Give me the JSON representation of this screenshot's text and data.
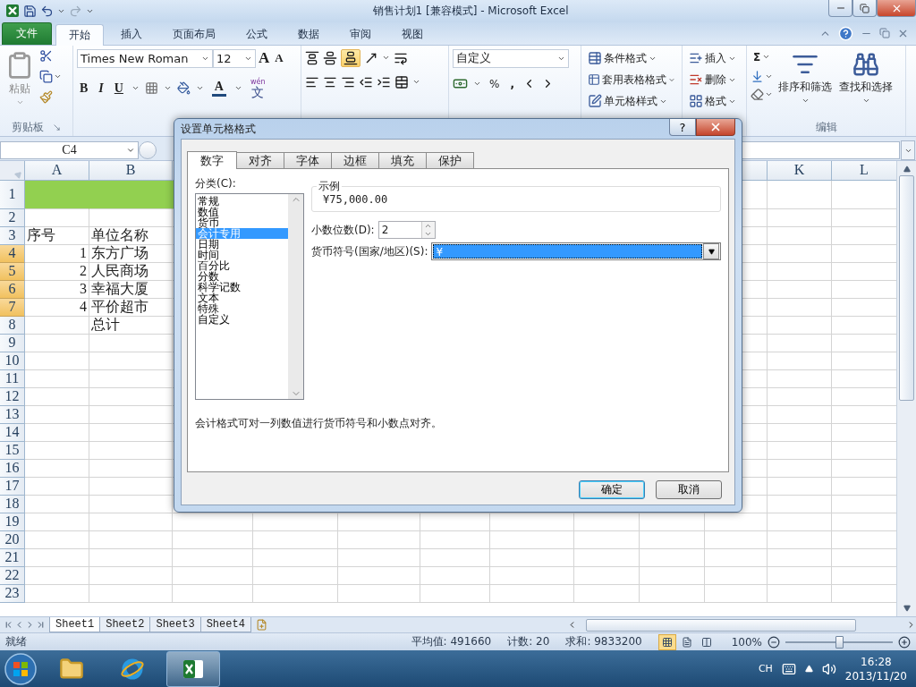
{
  "window": {
    "title": "销售计划1  [兼容模式]  -  Microsoft Excel"
  },
  "ribbon_tabs": [
    {
      "label": "文件",
      "kind": "file",
      "selected": false
    },
    {
      "label": "开始",
      "kind": "tab",
      "selected": true
    },
    {
      "label": "插入",
      "kind": "tab",
      "selected": false
    },
    {
      "label": "页面布局",
      "kind": "tab",
      "selected": false
    },
    {
      "label": "公式",
      "kind": "tab",
      "selected": false
    },
    {
      "label": "数据",
      "kind": "tab",
      "selected": false
    },
    {
      "label": "审阅",
      "kind": "tab",
      "selected": false
    },
    {
      "label": "视图",
      "kind": "tab",
      "selected": false
    }
  ],
  "ribbon": {
    "clipboard": {
      "paste": "粘贴",
      "label": "剪贴板"
    },
    "font": {
      "name": "Times New Roman",
      "size": "12",
      "grow": "A",
      "shrink": "A",
      "bold": "B",
      "italic": "I",
      "underline": "U",
      "font_color_letter": "A",
      "phonetic_ruby": "wén",
      "phonetic": "文"
    },
    "number": {
      "format": "自定义",
      "percent": "%",
      "comma": ","
    },
    "styles": [
      "条件格式",
      "套用表格格式",
      "单元格样式"
    ],
    "cells": [
      "插入",
      "删除",
      "格式"
    ],
    "editing": {
      "sum": "Σ",
      "sort": "排序和筛选",
      "find": "查找和选择",
      "label": "编辑"
    }
  },
  "name_box": "C4",
  "columns": [
    {
      "label": "A"
    },
    {
      "label": "B"
    },
    {},
    {},
    {},
    {},
    {},
    {},
    {},
    {},
    {
      "label": "K"
    },
    {
      "label": "L"
    }
  ],
  "rows": [
    {
      "number": "1",
      "kind": "title",
      "selected": false
    },
    {
      "number": "2",
      "kind": "plain",
      "selected": false
    },
    {
      "number": "3",
      "kind": "plain",
      "selected": false,
      "cells": [
        {
          "text": "序号",
          "kind": "text"
        },
        {
          "text": "单位名称",
          "kind": "text"
        }
      ]
    },
    {
      "number": "4",
      "kind": "plain",
      "selected": true,
      "cells": [
        {
          "text": "1",
          "kind": "number"
        },
        {
          "text": "东方广场",
          "kind": "text"
        }
      ]
    },
    {
      "number": "5",
      "kind": "plain",
      "selected": true,
      "cells": [
        {
          "text": "2",
          "kind": "number"
        },
        {
          "text": "人民商场",
          "kind": "text"
        }
      ]
    },
    {
      "number": "6",
      "kind": "plain",
      "selected": true,
      "cells": [
        {
          "text": "3",
          "kind": "number"
        },
        {
          "text": "幸福大厦",
          "kind": "text"
        }
      ]
    },
    {
      "number": "7",
      "kind": "plain",
      "selected": true,
      "cells": [
        {
          "text": "4",
          "kind": "number"
        },
        {
          "text": "平价超市",
          "kind": "text"
        }
      ]
    },
    {
      "number": "8",
      "kind": "plain",
      "selected": false,
      "cells": [
        null,
        {
          "text": "总计",
          "kind": "text"
        }
      ]
    },
    {
      "number": "9",
      "kind": "plain",
      "selected": false
    },
    {
      "number": "10",
      "kind": "plain",
      "selected": false
    },
    {
      "number": "11",
      "kind": "plain",
      "selected": false
    },
    {
      "number": "12",
      "kind": "plain",
      "selected": false
    },
    {
      "number": "13",
      "kind": "plain",
      "selected": false
    },
    {
      "number": "14",
      "kind": "plain",
      "selected": false
    },
    {
      "number": "15",
      "kind": "plain",
      "selected": false
    },
    {
      "number": "16",
      "kind": "plain",
      "selected": false
    },
    {
      "number": "17",
      "kind": "plain",
      "selected": false
    },
    {
      "number": "18",
      "kind": "plain",
      "selected": false
    },
    {
      "number": "19",
      "kind": "plain",
      "selected": false
    },
    {
      "number": "20",
      "kind": "plain",
      "selected": false
    },
    {
      "number": "21",
      "kind": "plain",
      "selected": false
    },
    {
      "number": "22",
      "kind": "plain",
      "selected": false
    },
    {
      "number": "23",
      "kind": "plain",
      "selected": false
    }
  ],
  "sheet_tabs": [
    {
      "label": "Sheet1",
      "selected": true
    },
    {
      "label": "Sheet2",
      "selected": false
    },
    {
      "label": "Sheet3",
      "selected": false
    },
    {
      "label": "Sheet4",
      "selected": false
    }
  ],
  "status_bar": {
    "ready": "就绪",
    "average": "平均值: 491660",
    "count": "计数: 20",
    "sum": "求和: 9833200",
    "views": [
      {
        "kind": "normal",
        "selected": true
      },
      {
        "kind": "layout",
        "selected": false
      },
      {
        "kind": "break",
        "selected": false
      }
    ],
    "zoom": {
      "label": "100%",
      "level": 0.5
    }
  },
  "taskbar": {
    "apps": [
      {
        "kind": "explorer",
        "selected": false
      },
      {
        "kind": "browser",
        "selected": false
      },
      {
        "kind": "excel",
        "selected": true
      }
    ],
    "language": "CH",
    "time": "16:28",
    "date": "2013/11/20"
  },
  "dialog": {
    "title": "设置单元格格式",
    "help": "?",
    "tabs": [
      {
        "label": "数字",
        "selected": true
      },
      {
        "label": "对齐",
        "selected": false
      },
      {
        "label": "字体",
        "selected": false
      },
      {
        "label": "边框",
        "selected": false
      },
      {
        "label": "填充",
        "selected": false
      },
      {
        "label": "保护",
        "selected": false
      }
    ],
    "category_label": "分类(C):",
    "categories": [
      {
        "label": "常规",
        "selected": false
      },
      {
        "label": "数值",
        "selected": false
      },
      {
        "label": "货币",
        "selected": false
      },
      {
        "label": "会计专用",
        "selected": true
      },
      {
        "label": "日期",
        "selected": false
      },
      {
        "label": "时间",
        "selected": false
      },
      {
        "label": "百分比",
        "selected": false
      },
      {
        "label": "分数",
        "selected": false
      },
      {
        "label": "科学记数",
        "selected": false
      },
      {
        "label": "文本",
        "selected": false
      },
      {
        "label": "特殊",
        "selected": false
      },
      {
        "label": "自定义",
        "selected": false
      }
    ],
    "sample_label": "示例",
    "sample": "¥75,000.00",
    "decimals_label": "小数位数(D):",
    "decimals": "2",
    "currency_label": "货币符号(国家/地区)(S):",
    "currency": "¥",
    "description": "会计格式可对一列数值进行货币符号和小数点对齐。",
    "buttons": [
      {
        "label": "确定",
        "kind": "default"
      },
      {
        "label": "取消",
        "kind": "normal"
      }
    ]
  }
}
